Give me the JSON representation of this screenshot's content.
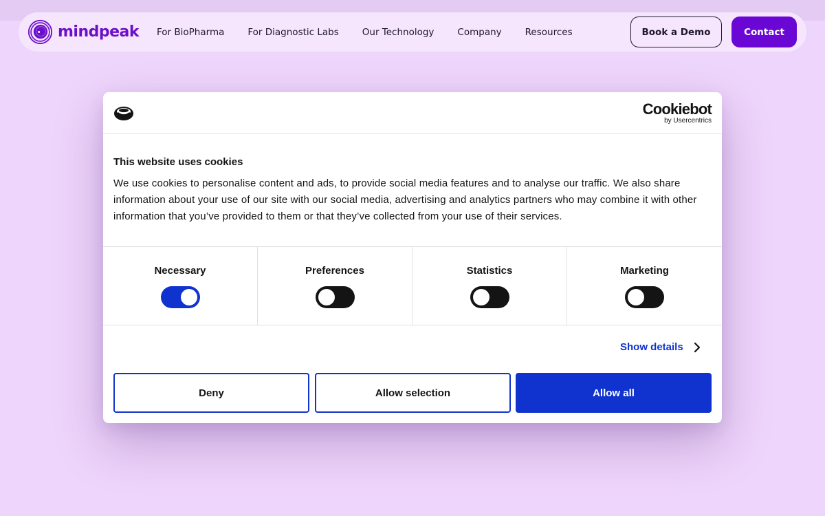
{
  "site": {
    "logo_text": "mindpeak",
    "nav": [
      {
        "label": "For BioPharma"
      },
      {
        "label": "For Diagnostic Labs"
      },
      {
        "label": "Our Technology"
      },
      {
        "label": "Company"
      },
      {
        "label": "Resources"
      }
    ],
    "book_demo_label": "Book a Demo",
    "contact_label": "Contact",
    "colors": {
      "brand": "#6a07d4",
      "page_bg": "#eed5fb"
    }
  },
  "cookie_dialog": {
    "provider_name": "Cookiebot",
    "provider_sub": "by Usercentrics",
    "title": "This website uses cookies",
    "body": "We use cookies to personalise content and ads, to provide social media features and to analyse our traffic. We also share information about your use of our site with our social media, advertising and analytics partners who may combine it with other information that you’ve provided to them or that they’ve collected from your use of their services.",
    "categories": [
      {
        "label": "Necessary",
        "enabled": true
      },
      {
        "label": "Preferences",
        "enabled": false
      },
      {
        "label": "Statistics",
        "enabled": false
      },
      {
        "label": "Marketing",
        "enabled": false
      }
    ],
    "show_details_label": "Show details",
    "deny_label": "Deny",
    "allow_selection_label": "Allow selection",
    "allow_all_label": "Allow all",
    "colors": {
      "accent": "#1032cf",
      "toggle_off": "#141414"
    }
  }
}
